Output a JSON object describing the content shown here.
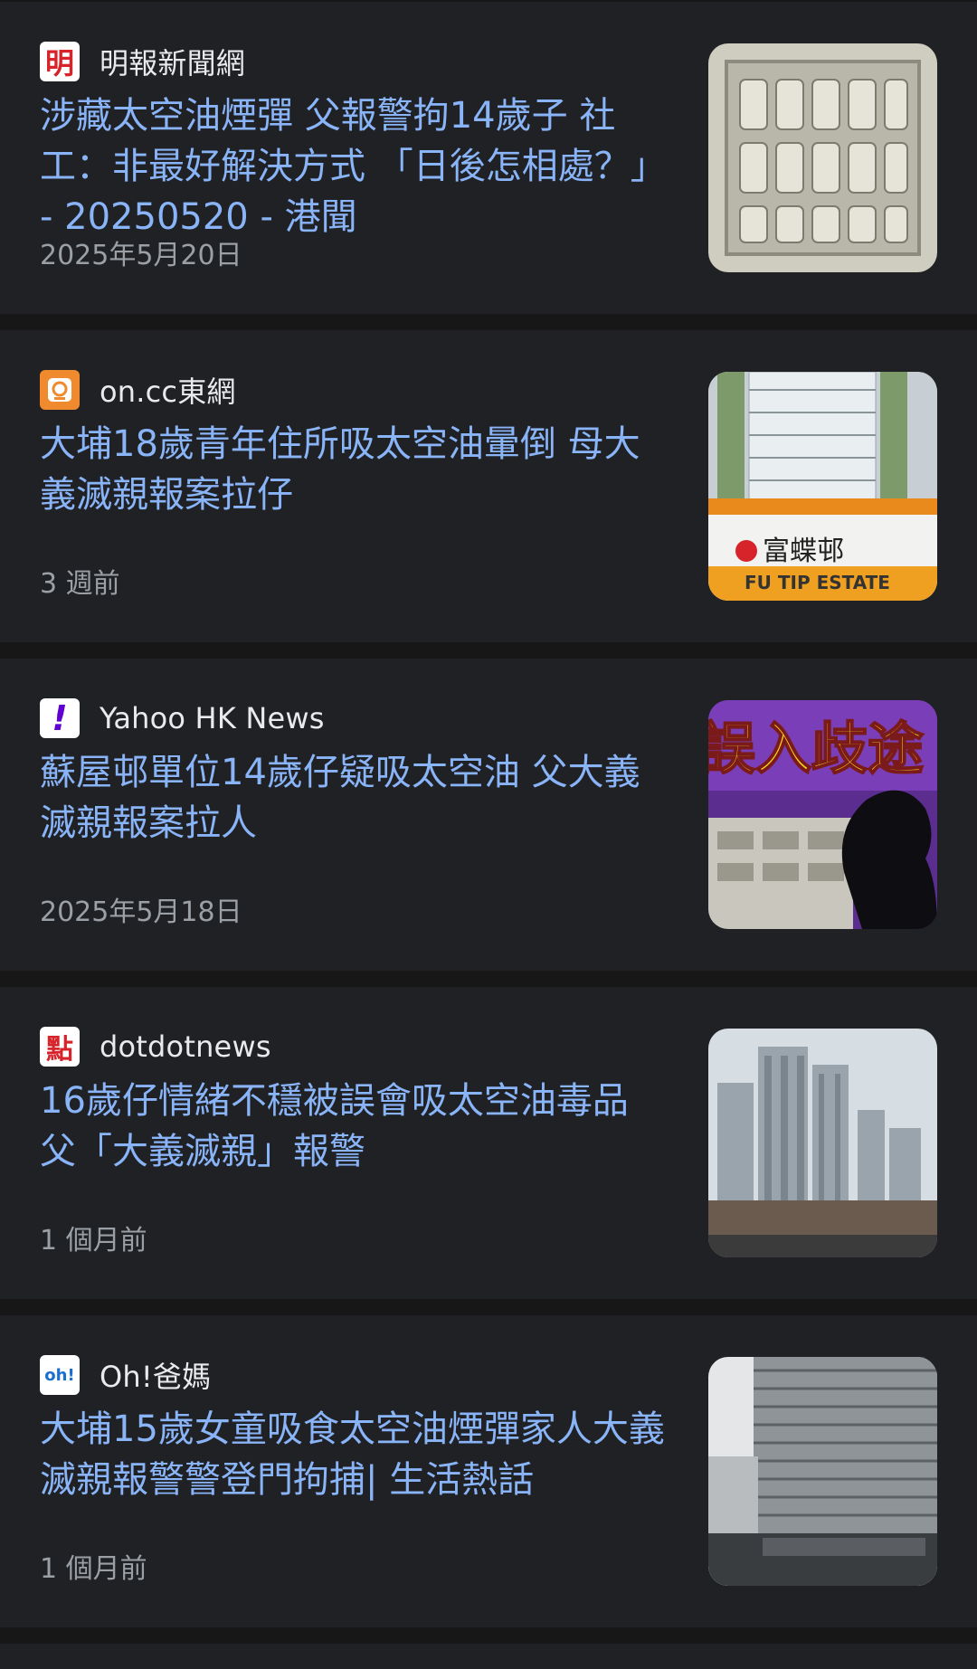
{
  "articles": [
    {
      "source": "明報新聞網",
      "logo_icon": "ming-pao-logo-icon",
      "logo_text": "明",
      "title": "涉藏太空油煙彈 父報警拘14歲子 社工：非最好解決方式 「日後怎相處？」 - 20250520 - 港聞",
      "time": "2025年5月20日",
      "thumbnail": "seized-vape-cartridges-photo"
    },
    {
      "source": "on.cc東網",
      "logo_icon": "oncc-logo-icon",
      "logo_text": "",
      "title": "大埔18歲青年住所吸太空油暈倒 母大義滅親報案拉仔",
      "time": "3 週前",
      "thumbnail": "fu-tip-estate-photo",
      "thumb_sign_cn": "富蝶邨",
      "thumb_sign_en": "FU TIP ESTATE"
    },
    {
      "source": "Yahoo HK News",
      "logo_icon": "yahoo-logo-icon",
      "logo_text": "!",
      "title": "蘇屋邨單位14歲仔疑吸太空油 父大義滅親報案拉人",
      "time": "2025年5月18日",
      "thumbnail": "news-graphic-photo",
      "thumb_text": "誤入歧途"
    },
    {
      "source": "dotdotnews",
      "logo_icon": "dotdotnews-logo-icon",
      "logo_text": "點",
      "title": "16歲仔情緒不穩被誤會吸太空油毒品 父「大義滅親」報警",
      "time": "1 個月前",
      "thumbnail": "residential-towers-photo"
    },
    {
      "source": "Oh!爸媽",
      "logo_icon": "ohpama-logo-icon",
      "logo_text": "oh!",
      "title": "大埔15歲女童吸食太空油煙彈家人大義滅親報警警登門拘捕| 生活熱話",
      "time": "1 個月前",
      "thumbnail": "police-building-photo"
    }
  ],
  "colors": {
    "background": "#202124",
    "divider": "#171717",
    "title": "#8ab4f8",
    "source": "#e8eaed",
    "time": "#9aa0a6"
  }
}
